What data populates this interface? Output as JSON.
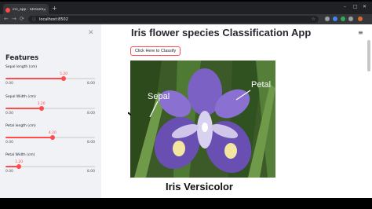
{
  "browser": {
    "tab_title": "iris_app · Streamlit",
    "new_tab": "+",
    "url": "localhost:8502",
    "window_controls": [
      "–",
      "□",
      "✕"
    ]
  },
  "sidebar": {
    "close_glyph": "✕",
    "heading": "Features",
    "sliders": [
      {
        "label": "Sepal length (cm)",
        "value": "5.20",
        "min": "0.00",
        "max": "8.00",
        "fraction": 0.65
      },
      {
        "label": "Sepal Width (cm)",
        "value": "3.20",
        "min": "0.00",
        "max": "8.00",
        "fraction": 0.4
      },
      {
        "label": "Petal length (cm)",
        "value": "4.20",
        "min": "0.00",
        "max": "8.00",
        "fraction": 0.525
      },
      {
        "label": "Petal Width (cm)",
        "value": "1.20",
        "min": "0.00",
        "max": "8.00",
        "fraction": 0.15
      }
    ]
  },
  "main": {
    "title": "Iris flower species Classification App",
    "menu_glyph": "≡",
    "classify_label": "Click Here to Classify",
    "image_labels": {
      "sepal": "Sepal",
      "petal": "Petal"
    },
    "result": "Iris Versicolor"
  },
  "colors": {
    "accent": "#ff4b4b",
    "sidebar_bg": "#f0f2f6"
  }
}
